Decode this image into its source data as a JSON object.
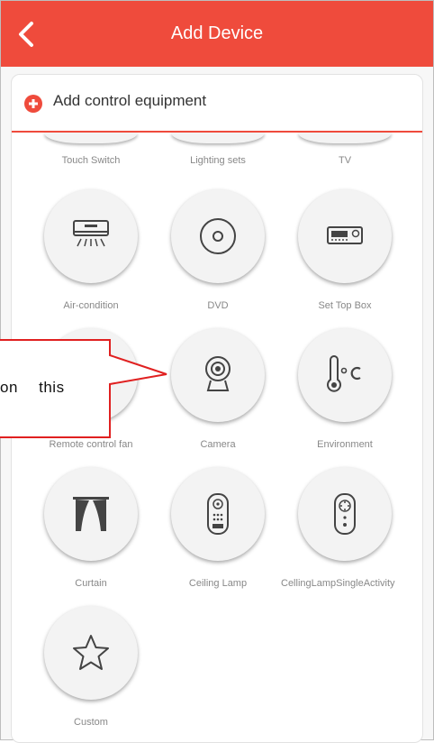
{
  "header": {
    "title": "Add Device"
  },
  "add_row": {
    "label": "Add control equipment"
  },
  "top_row": [
    "Touch Switch",
    "Lighting sets",
    "TV"
  ],
  "devices": [
    {
      "label": "Air-condition",
      "icon": "air-conditioner-icon"
    },
    {
      "label": "DVD",
      "icon": "disc-icon"
    },
    {
      "label": "Set Top Box",
      "icon": "set-top-box-icon"
    },
    {
      "label": "Remote control fan",
      "icon": "fan-icon"
    },
    {
      "label": "Camera",
      "icon": "camera-icon"
    },
    {
      "label": "Environment",
      "icon": "thermometer-icon"
    },
    {
      "label": "Curtain",
      "icon": "curtain-icon"
    },
    {
      "label": "Ceiling Lamp",
      "icon": "remote-icon"
    },
    {
      "label": "CellingLampSingleActivity",
      "icon": "single-remote-icon"
    },
    {
      "label": "Custom",
      "icon": "star-icon"
    }
  ],
  "callout": {
    "text": "on this"
  },
  "colors": {
    "accent": "#ef4b3c",
    "callout_border": "#e02020"
  }
}
